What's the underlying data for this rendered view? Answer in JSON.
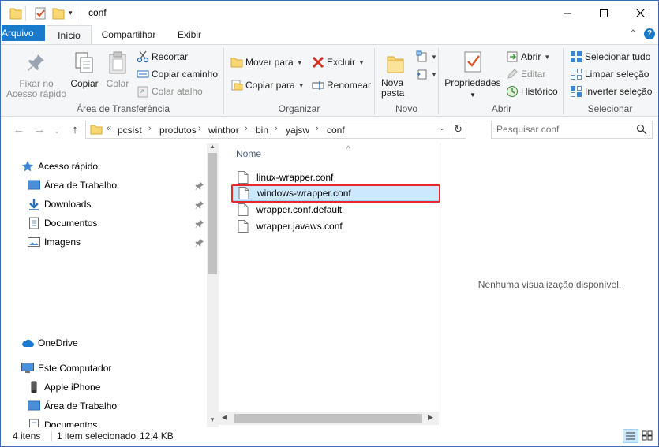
{
  "window": {
    "title": "conf",
    "controls": {
      "minimize": "—",
      "maximize": "☐",
      "close": "✕"
    }
  },
  "tabs": {
    "file": "Arquivo",
    "home": "Início",
    "share": "Compartilhar",
    "view": "Exibir"
  },
  "ribbon": {
    "clipboard": {
      "group": "Área de Transferência",
      "pin_quick_access": "Fixar no Acesso rápido",
      "copy": "Copiar",
      "paste": "Colar",
      "cut": "Recortar",
      "copy_path": "Copiar caminho",
      "paste_shortcut": "Colar atalho"
    },
    "organize": {
      "group": "Organizar",
      "move_to": "Mover para",
      "copy_to": "Copiar para",
      "delete": "Excluir",
      "rename": "Renomear"
    },
    "new": {
      "group": "Novo",
      "new_folder": "Nova pasta"
    },
    "open": {
      "group": "Abrir",
      "properties": "Propriedades",
      "open": "Abrir",
      "edit": "Editar",
      "history": "Histórico"
    },
    "select": {
      "group": "Selecionar",
      "select_all": "Selecionar tudo",
      "select_none": "Limpar seleção",
      "invert": "Inverter seleção"
    }
  },
  "address": {
    "overflow": "«",
    "crumbs": [
      "pcsist",
      "produtos",
      "winthor",
      "bin",
      "yajsw",
      "conf"
    ],
    "search_placeholder": "Pesquisar conf"
  },
  "nav": {
    "quick_access": "Acesso rápido",
    "quick_items": [
      "Área de Trabalho",
      "Downloads",
      "Documentos",
      "Imagens"
    ],
    "onedrive": "OneDrive",
    "this_pc": "Este Computador",
    "pc_items": [
      "Apple iPhone",
      "Área de Trabalho",
      "Documentos"
    ]
  },
  "files": {
    "column_name": "Nome",
    "items": [
      {
        "name": "linux-wrapper.conf",
        "selected": false
      },
      {
        "name": "windows-wrapper.conf",
        "selected": true
      },
      {
        "name": "wrapper.conf.default",
        "selected": false
      },
      {
        "name": "wrapper.javaws.conf",
        "selected": false
      }
    ]
  },
  "preview": {
    "message": "Nenhuma visualização disponível."
  },
  "status": {
    "count": "4 itens",
    "selection": "1 item selecionado",
    "size": "12,4 KB"
  },
  "colors": {
    "accent": "#1979ca",
    "selection": "#cce8ff",
    "highlight_box": "#e8282d",
    "folder": "#f8d775"
  }
}
